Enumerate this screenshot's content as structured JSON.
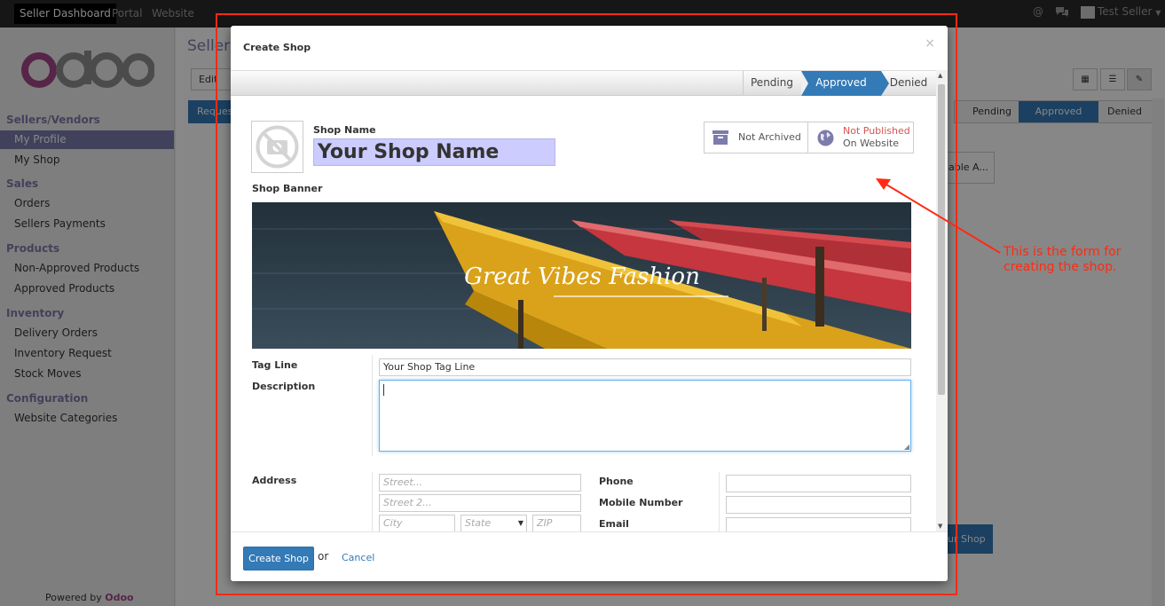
{
  "topbar": {
    "nav": [
      "Seller Dashboard",
      "Portal",
      "Website"
    ],
    "user": "Test Seller"
  },
  "sidebar": {
    "logo": "odoo",
    "sections": [
      {
        "title": "Sellers/Vendors",
        "items": [
          "My Profile",
          "My Shop"
        ]
      },
      {
        "title": "Sales",
        "items": [
          "Orders",
          "Sellers Payments"
        ]
      },
      {
        "title": "Products",
        "items": [
          "Non-Approved Products",
          "Approved Products"
        ]
      },
      {
        "title": "Inventory",
        "items": [
          "Delivery Orders",
          "Inventory Request",
          "Stock Moves"
        ]
      },
      {
        "title": "Configuration",
        "items": [
          "Website Categories"
        ]
      }
    ],
    "active_item": "My Profile",
    "powered_by": "Powered by",
    "powered_brand": "Odoo"
  },
  "background": {
    "breadcrumb": "Sellers",
    "edit_button": "Edit",
    "request_tab": "Reques",
    "stages": [
      "Pending",
      "Approved",
      "Denied"
    ],
    "available_button": "able A...",
    "shop_button": "ur Shop"
  },
  "modal": {
    "title": "Create Shop",
    "close": "×",
    "stages": {
      "pending": "Pending",
      "approved": "Approved",
      "denied": "Denied"
    },
    "shop_name_label": "Shop Name",
    "shop_name_value": "Your Shop Name",
    "archive_button": "Not Archived",
    "publish_line1": "Not Published",
    "publish_line2": "On Website",
    "shop_banner_label": "Shop Banner",
    "banner_text": "Great Vibes Fashion",
    "tag_line_label": "Tag Line",
    "tag_line_value": "Your Shop Tag Line",
    "description_label": "Description",
    "address_label": "Address",
    "street_placeholder": "Street...",
    "street2_placeholder": "Street 2...",
    "city_placeholder": "City",
    "state_placeholder": "State",
    "zip_placeholder": "ZIP",
    "phone_label": "Phone",
    "mobile_label": "Mobile Number",
    "email_label": "Email",
    "create_button": "Create Shop",
    "or_text": "or",
    "cancel_link": "Cancel"
  },
  "annotation": {
    "text_line1": "This is the form for",
    "text_line2": "creating the shop.",
    "color": "#ff2a12"
  },
  "colors": {
    "brand": "#a24689",
    "primary": "#337ab7",
    "sidebar_accent": "#7c7bad"
  }
}
